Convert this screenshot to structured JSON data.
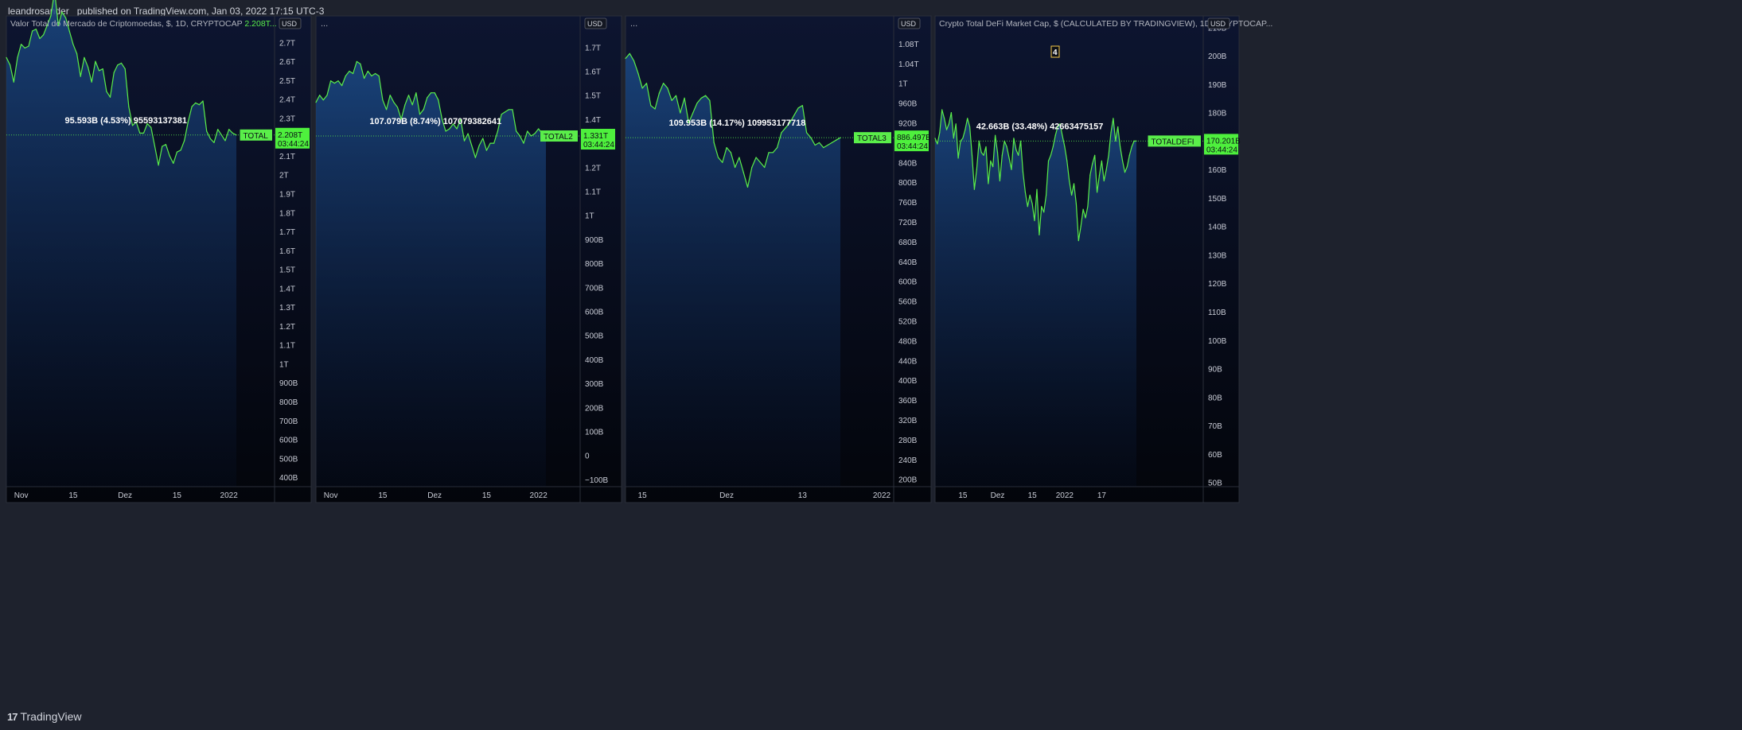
{
  "header": {
    "published_text": "leandrosander_ published on TradingView.com, Jan 03, 2022 17:15 UTC-3"
  },
  "footer": {
    "brand": "TradingView",
    "brand_mark": "17"
  },
  "colors": {
    "line": "#5aee4a",
    "tag_bg": "#5aee4a",
    "price_tag_bg": "#4ef03d",
    "background": "#131722"
  },
  "chart_data": [
    {
      "type": "area",
      "title": "Valor Total do Mercado de Criptomoedas, $, 1D, CRYPTOCAP",
      "title_value": "2.208T...",
      "currency_button": "USD",
      "symbol_tag": "TOTAL",
      "last_price": "2.208T",
      "countdown": "03:44:24",
      "range_label": "95.593B (4.53%) 95593137381",
      "y_unit": "T",
      "ylim": [
        0.35,
        2.84
      ],
      "y_ticks": [
        "2.8T",
        "2.7T",
        "2.6T",
        "2.5T",
        "2.4T",
        "2.3T",
        "2.2T",
        "2.1T",
        "2T",
        "1.9T",
        "1.8T",
        "1.7T",
        "1.6T",
        "1.5T",
        "1.4T",
        "1.3T",
        "1.2T",
        "1.1T",
        "1T",
        "900B",
        "800B",
        "700B",
        "600B",
        "500B",
        "400B"
      ],
      "y_tick_values": [
        2.8,
        2.7,
        2.6,
        2.5,
        2.4,
        2.3,
        2.2,
        2.1,
        2.0,
        1.9,
        1.8,
        1.7,
        1.6,
        1.5,
        1.4,
        1.3,
        1.2,
        1.1,
        1.0,
        0.9,
        0.8,
        0.7,
        0.6,
        0.5,
        0.4
      ],
      "x_ticks": [
        "Nov",
        "15",
        "Dez",
        "15",
        "2022"
      ],
      "x_tick_index": [
        4,
        18,
        32,
        46,
        60
      ],
      "values": [
        2.62,
        2.58,
        2.49,
        2.62,
        2.69,
        2.67,
        2.68,
        2.76,
        2.77,
        2.72,
        2.74,
        2.79,
        2.84,
        2.97,
        2.79,
        2.86,
        2.83,
        2.76,
        2.69,
        2.64,
        2.52,
        2.62,
        2.57,
        2.49,
        2.6,
        2.55,
        2.56,
        2.44,
        2.41,
        2.54,
        2.58,
        2.59,
        2.56,
        2.36,
        2.26,
        2.28,
        2.22,
        2.22,
        2.27,
        2.25,
        2.15,
        2.05,
        2.15,
        2.16,
        2.1,
        2.06,
        2.12,
        2.13,
        2.18,
        2.28,
        2.36,
        2.38,
        2.37,
        2.39,
        2.23,
        2.19,
        2.17,
        2.24,
        2.21,
        2.18,
        2.24,
        2.22,
        2.21
      ]
    },
    {
      "type": "area",
      "title": "",
      "title_value": "...",
      "currency_button": "USD",
      "symbol_tag": "TOTAL2",
      "last_price": "1.331T",
      "countdown": "03:44:24",
      "range_label": "107.079B (8.74%) 107079382641",
      "y_unit": "T",
      "ylim": [
        -0.13,
        1.83
      ],
      "y_ticks": [
        "1.8T",
        "1.7T",
        "1.6T",
        "1.5T",
        "1.4T",
        "1.3T",
        "1.2T",
        "1.1T",
        "1T",
        "900B",
        "800B",
        "700B",
        "600B",
        "500B",
        "400B",
        "300B",
        "200B",
        "100B",
        "0",
        "−100B"
      ],
      "y_tick_values": [
        1.8,
        1.7,
        1.6,
        1.5,
        1.4,
        1.3,
        1.2,
        1.1,
        1.0,
        0.9,
        0.8,
        0.7,
        0.6,
        0.5,
        0.4,
        0.3,
        0.2,
        0.1,
        0.0,
        -0.1
      ],
      "x_ticks": [
        "Nov",
        "15",
        "Dez",
        "15",
        "2022"
      ],
      "x_tick_index": [
        4,
        18,
        32,
        46,
        60
      ],
      "values": [
        1.47,
        1.5,
        1.48,
        1.5,
        1.56,
        1.55,
        1.56,
        1.54,
        1.58,
        1.6,
        1.59,
        1.64,
        1.63,
        1.57,
        1.6,
        1.58,
        1.59,
        1.58,
        1.48,
        1.44,
        1.5,
        1.47,
        1.45,
        1.4,
        1.46,
        1.5,
        1.46,
        1.51,
        1.42,
        1.44,
        1.49,
        1.51,
        1.51,
        1.48,
        1.4,
        1.35,
        1.36,
        1.38,
        1.36,
        1.4,
        1.31,
        1.34,
        1.29,
        1.24,
        1.29,
        1.32,
        1.27,
        1.3,
        1.3,
        1.35,
        1.42,
        1.43,
        1.44,
        1.44,
        1.35,
        1.33,
        1.3,
        1.35,
        1.33,
        1.34,
        1.36,
        1.34,
        1.33
      ]
    },
    {
      "type": "area",
      "title": "",
      "title_value": "...",
      "currency_button": "USD",
      "symbol_tag": "TOTAL3",
      "last_price": "886.497B",
      "countdown": "03:44:24",
      "range_label": "109.953B (14.17%) 109953177718",
      "y_unit": "B",
      "ylim": [
        185,
        1136
      ],
      "y_ticks": [
        "1.12T",
        "1.08T",
        "1.04T",
        "1T",
        "960B",
        "920B",
        "880B",
        "840B",
        "800B",
        "760B",
        "720B",
        "680B",
        "640B",
        "600B",
        "560B",
        "520B",
        "480B",
        "440B",
        "400B",
        "360B",
        "320B",
        "280B",
        "240B",
        "200B"
      ],
      "y_tick_values": [
        1120,
        1080,
        1040,
        1000,
        960,
        920,
        880,
        840,
        800,
        760,
        720,
        680,
        640,
        600,
        560,
        520,
        480,
        440,
        400,
        360,
        320,
        280,
        240,
        200
      ],
      "x_ticks": [
        "15",
        "Dez",
        "13",
        "2022"
      ],
      "x_tick_index": [
        4,
        24,
        42,
        64
      ],
      "values": [
        1050,
        1060,
        1045,
        1020,
        990,
        1000,
        955,
        948,
        980,
        1000,
        990,
        965,
        975,
        940,
        970,
        920,
        940,
        960,
        970,
        975,
        965,
        880,
        850,
        840,
        870,
        860,
        830,
        850,
        820,
        790,
        830,
        850,
        840,
        830,
        860,
        860,
        870,
        900,
        910,
        920,
        935,
        950,
        955,
        900,
        890,
        875,
        880,
        870,
        875,
        880,
        885,
        890
      ]
    },
    {
      "type": "area",
      "title": "Crypto Total DeFi Market Cap, $ (CALCULATED BY TRADINGVIEW), 1D, CRYPTOCAP...",
      "title_value": "",
      "currency_button": "USD",
      "symbol_tag": "TOTALDEFI",
      "last_price": "170.201B",
      "countdown": "03:44:24",
      "range_label": "42.663B (33.48%) 42663475157",
      "marker": "4",
      "y_unit": "B",
      "ylim": [
        48.5,
        214
      ],
      "y_ticks": [
        "210B",
        "200B",
        "190B",
        "180B",
        "170B",
        "160B",
        "150B",
        "140B",
        "130B",
        "120B",
        "110B",
        "100B",
        "90B",
        "80B",
        "70B",
        "60B",
        "50B"
      ],
      "y_tick_values": [
        210,
        200,
        190,
        180,
        170,
        160,
        150,
        140,
        130,
        120,
        110,
        100,
        90,
        80,
        70,
        60,
        50
      ],
      "x_ticks": [
        "15",
        "Dez",
        "15",
        "2022",
        "17"
      ],
      "x_tick_index": [
        12,
        27,
        42,
        56,
        72
      ],
      "values": [
        171,
        169,
        173,
        181,
        178,
        174,
        176,
        180,
        171,
        176,
        164,
        170,
        171,
        174,
        178,
        175,
        165,
        153,
        160,
        170,
        166,
        165,
        168,
        155,
        163,
        161,
        172,
        166,
        156,
        165,
        170,
        168,
        164,
        160,
        171,
        167,
        165,
        170,
        159,
        152,
        147,
        151,
        148,
        142,
        153,
        137,
        147,
        145,
        151,
        163,
        165,
        168,
        172,
        175,
        176,
        172,
        168,
        163,
        156,
        151,
        155,
        148,
        135,
        140,
        146,
        143,
        147,
        158,
        162,
        165,
        152,
        158,
        163,
        156,
        160,
        165,
        173,
        178,
        170,
        175,
        168,
        163,
        159,
        161,
        165,
        168,
        170,
        170
      ]
    }
  ]
}
